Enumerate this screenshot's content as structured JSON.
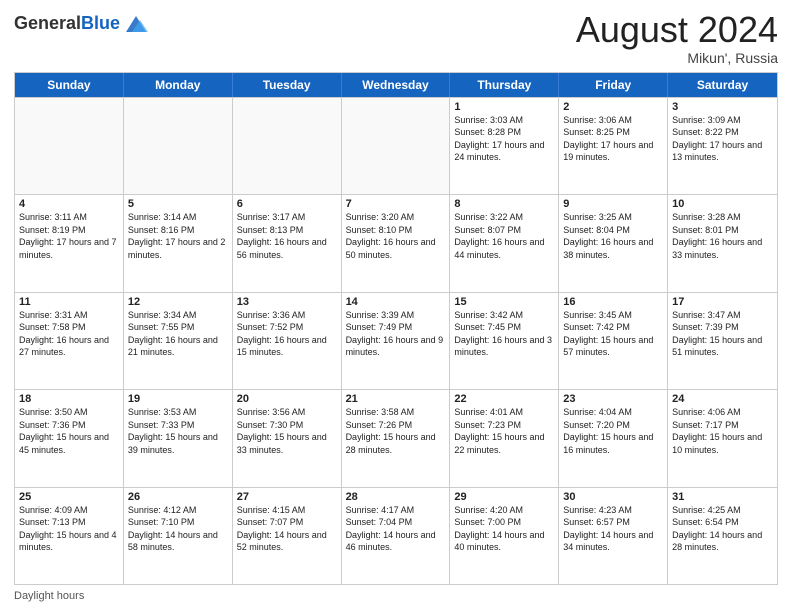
{
  "header": {
    "logo_general": "General",
    "logo_blue": "Blue",
    "month_title": "August 2024",
    "location": "Mikun', Russia"
  },
  "days_of_week": [
    "Sunday",
    "Monday",
    "Tuesday",
    "Wednesday",
    "Thursday",
    "Friday",
    "Saturday"
  ],
  "weeks": [
    [
      {
        "day": "",
        "sunrise": "",
        "sunset": "",
        "daylight": "",
        "empty": true
      },
      {
        "day": "",
        "sunrise": "",
        "sunset": "",
        "daylight": "",
        "empty": true
      },
      {
        "day": "",
        "sunrise": "",
        "sunset": "",
        "daylight": "",
        "empty": true
      },
      {
        "day": "",
        "sunrise": "",
        "sunset": "",
        "daylight": "",
        "empty": true
      },
      {
        "day": "1",
        "sunrise": "Sunrise: 3:03 AM",
        "sunset": "Sunset: 8:28 PM",
        "daylight": "Daylight: 17 hours and 24 minutes.",
        "empty": false
      },
      {
        "day": "2",
        "sunrise": "Sunrise: 3:06 AM",
        "sunset": "Sunset: 8:25 PM",
        "daylight": "Daylight: 17 hours and 19 minutes.",
        "empty": false
      },
      {
        "day": "3",
        "sunrise": "Sunrise: 3:09 AM",
        "sunset": "Sunset: 8:22 PM",
        "daylight": "Daylight: 17 hours and 13 minutes.",
        "empty": false
      }
    ],
    [
      {
        "day": "4",
        "sunrise": "Sunrise: 3:11 AM",
        "sunset": "Sunset: 8:19 PM",
        "daylight": "Daylight: 17 hours and 7 minutes.",
        "empty": false
      },
      {
        "day": "5",
        "sunrise": "Sunrise: 3:14 AM",
        "sunset": "Sunset: 8:16 PM",
        "daylight": "Daylight: 17 hours and 2 minutes.",
        "empty": false
      },
      {
        "day": "6",
        "sunrise": "Sunrise: 3:17 AM",
        "sunset": "Sunset: 8:13 PM",
        "daylight": "Daylight: 16 hours and 56 minutes.",
        "empty": false
      },
      {
        "day": "7",
        "sunrise": "Sunrise: 3:20 AM",
        "sunset": "Sunset: 8:10 PM",
        "daylight": "Daylight: 16 hours and 50 minutes.",
        "empty": false
      },
      {
        "day": "8",
        "sunrise": "Sunrise: 3:22 AM",
        "sunset": "Sunset: 8:07 PM",
        "daylight": "Daylight: 16 hours and 44 minutes.",
        "empty": false
      },
      {
        "day": "9",
        "sunrise": "Sunrise: 3:25 AM",
        "sunset": "Sunset: 8:04 PM",
        "daylight": "Daylight: 16 hours and 38 minutes.",
        "empty": false
      },
      {
        "day": "10",
        "sunrise": "Sunrise: 3:28 AM",
        "sunset": "Sunset: 8:01 PM",
        "daylight": "Daylight: 16 hours and 33 minutes.",
        "empty": false
      }
    ],
    [
      {
        "day": "11",
        "sunrise": "Sunrise: 3:31 AM",
        "sunset": "Sunset: 7:58 PM",
        "daylight": "Daylight: 16 hours and 27 minutes.",
        "empty": false
      },
      {
        "day": "12",
        "sunrise": "Sunrise: 3:34 AM",
        "sunset": "Sunset: 7:55 PM",
        "daylight": "Daylight: 16 hours and 21 minutes.",
        "empty": false
      },
      {
        "day": "13",
        "sunrise": "Sunrise: 3:36 AM",
        "sunset": "Sunset: 7:52 PM",
        "daylight": "Daylight: 16 hours and 15 minutes.",
        "empty": false
      },
      {
        "day": "14",
        "sunrise": "Sunrise: 3:39 AM",
        "sunset": "Sunset: 7:49 PM",
        "daylight": "Daylight: 16 hours and 9 minutes.",
        "empty": false
      },
      {
        "day": "15",
        "sunrise": "Sunrise: 3:42 AM",
        "sunset": "Sunset: 7:45 PM",
        "daylight": "Daylight: 16 hours and 3 minutes.",
        "empty": false
      },
      {
        "day": "16",
        "sunrise": "Sunrise: 3:45 AM",
        "sunset": "Sunset: 7:42 PM",
        "daylight": "Daylight: 15 hours and 57 minutes.",
        "empty": false
      },
      {
        "day": "17",
        "sunrise": "Sunrise: 3:47 AM",
        "sunset": "Sunset: 7:39 PM",
        "daylight": "Daylight: 15 hours and 51 minutes.",
        "empty": false
      }
    ],
    [
      {
        "day": "18",
        "sunrise": "Sunrise: 3:50 AM",
        "sunset": "Sunset: 7:36 PM",
        "daylight": "Daylight: 15 hours and 45 minutes.",
        "empty": false
      },
      {
        "day": "19",
        "sunrise": "Sunrise: 3:53 AM",
        "sunset": "Sunset: 7:33 PM",
        "daylight": "Daylight: 15 hours and 39 minutes.",
        "empty": false
      },
      {
        "day": "20",
        "sunrise": "Sunrise: 3:56 AM",
        "sunset": "Sunset: 7:30 PM",
        "daylight": "Daylight: 15 hours and 33 minutes.",
        "empty": false
      },
      {
        "day": "21",
        "sunrise": "Sunrise: 3:58 AM",
        "sunset": "Sunset: 7:26 PM",
        "daylight": "Daylight: 15 hours and 28 minutes.",
        "empty": false
      },
      {
        "day": "22",
        "sunrise": "Sunrise: 4:01 AM",
        "sunset": "Sunset: 7:23 PM",
        "daylight": "Daylight: 15 hours and 22 minutes.",
        "empty": false
      },
      {
        "day": "23",
        "sunrise": "Sunrise: 4:04 AM",
        "sunset": "Sunset: 7:20 PM",
        "daylight": "Daylight: 15 hours and 16 minutes.",
        "empty": false
      },
      {
        "day": "24",
        "sunrise": "Sunrise: 4:06 AM",
        "sunset": "Sunset: 7:17 PM",
        "daylight": "Daylight: 15 hours and 10 minutes.",
        "empty": false
      }
    ],
    [
      {
        "day": "25",
        "sunrise": "Sunrise: 4:09 AM",
        "sunset": "Sunset: 7:13 PM",
        "daylight": "Daylight: 15 hours and 4 minutes.",
        "empty": false
      },
      {
        "day": "26",
        "sunrise": "Sunrise: 4:12 AM",
        "sunset": "Sunset: 7:10 PM",
        "daylight": "Daylight: 14 hours and 58 minutes.",
        "empty": false
      },
      {
        "day": "27",
        "sunrise": "Sunrise: 4:15 AM",
        "sunset": "Sunset: 7:07 PM",
        "daylight": "Daylight: 14 hours and 52 minutes.",
        "empty": false
      },
      {
        "day": "28",
        "sunrise": "Sunrise: 4:17 AM",
        "sunset": "Sunset: 7:04 PM",
        "daylight": "Daylight: 14 hours and 46 minutes.",
        "empty": false
      },
      {
        "day": "29",
        "sunrise": "Sunrise: 4:20 AM",
        "sunset": "Sunset: 7:00 PM",
        "daylight": "Daylight: 14 hours and 40 minutes.",
        "empty": false
      },
      {
        "day": "30",
        "sunrise": "Sunrise: 4:23 AM",
        "sunset": "Sunset: 6:57 PM",
        "daylight": "Daylight: 14 hours and 34 minutes.",
        "empty": false
      },
      {
        "day": "31",
        "sunrise": "Sunrise: 4:25 AM",
        "sunset": "Sunset: 6:54 PM",
        "daylight": "Daylight: 14 hours and 28 minutes.",
        "empty": false
      }
    ]
  ],
  "footer": {
    "note": "Daylight hours"
  }
}
